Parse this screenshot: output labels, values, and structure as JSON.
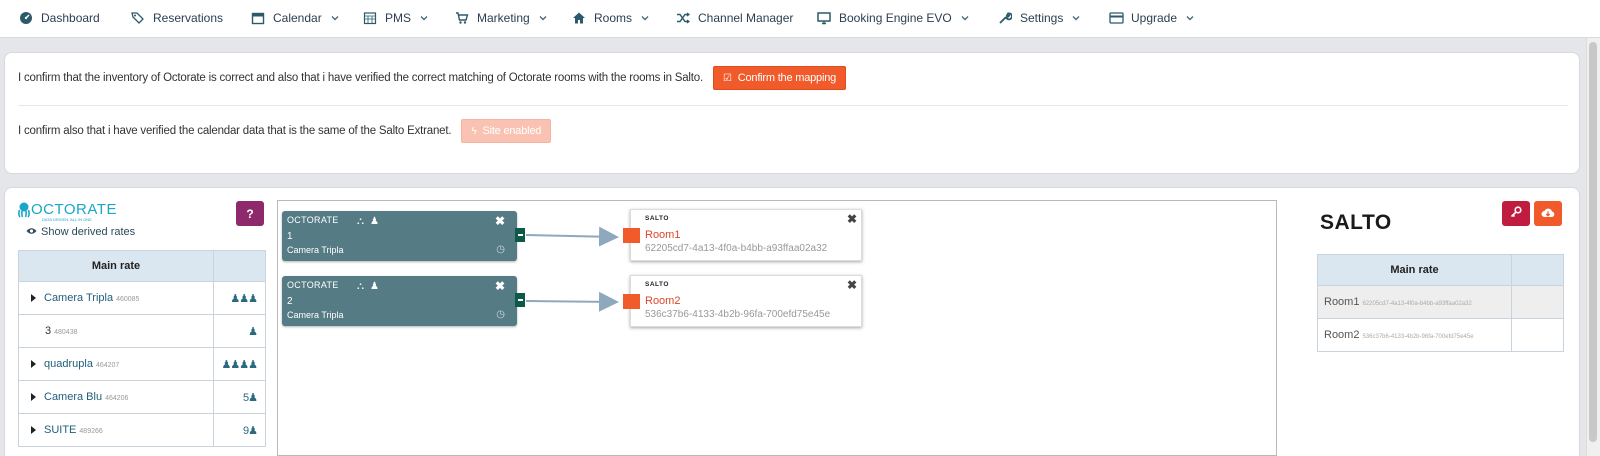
{
  "nav": [
    {
      "label": "Dashboard",
      "icon": "dashboard-icon",
      "chevron": false
    },
    {
      "label": "Reservations",
      "icon": "tags-icon",
      "chevron": false
    },
    {
      "label": "Calendar",
      "icon": "calendar-icon",
      "chevron": true
    },
    {
      "label": "PMS",
      "icon": "grid-calendar-icon",
      "chevron": true
    },
    {
      "label": "Marketing",
      "icon": "cart-icon",
      "chevron": true
    },
    {
      "label": "Rooms",
      "icon": "home-icon",
      "chevron": true
    },
    {
      "label": "Channel Manager",
      "icon": "shuffle-icon",
      "chevron": false
    },
    {
      "label": "Booking Engine EVO",
      "icon": "monitor-icon",
      "chevron": true
    },
    {
      "label": "Settings",
      "icon": "wrench-icon",
      "chevron": true
    },
    {
      "label": "Upgrade",
      "icon": "credit-card-icon",
      "chevron": true
    }
  ],
  "confirm": {
    "inventory_text": "I confirm that the inventory of Octorate is correct and also that i have verified the correct matching of Octorate rooms with the rooms in Salto.",
    "mapping_button": "Confirm the mapping",
    "calendar_text": "I confirm also that i have verified the calendar data that is the same of the Salto Extranet.",
    "site_button": "Site enabled"
  },
  "octorate_panel": {
    "logo_text": "OCTORATE",
    "logo_tagline": "DATA DRIVEN. ALL IN ONE",
    "derived_link": "Show derived rates",
    "help_label": "?",
    "table_header": "Main rate",
    "rates": [
      {
        "name": "Camera Tripla",
        "code": "460085",
        "occupancy": "♟♟♟",
        "expandable": true
      },
      {
        "name": "3",
        "code": "480438",
        "occupancy": "♟",
        "expandable": false
      },
      {
        "name": "quadrupla",
        "code": "464207",
        "occupancy": "♟♟♟♟",
        "expandable": true
      },
      {
        "name": "Camera Blu",
        "code": "464206",
        "occupancy": "5♟",
        "expandable": true
      },
      {
        "name": "SUITE",
        "code": "489266",
        "occupancy": "9♟",
        "expandable": true
      }
    ]
  },
  "mapping": {
    "octorate_nodes": [
      {
        "number": "1",
        "room": "Camera Tripla",
        "logo": "OCTORATE"
      },
      {
        "number": "2",
        "room": "Camera Tripla",
        "logo": "OCTORATE"
      }
    ],
    "salto_nodes": [
      {
        "logo": "SALTO",
        "room": "Room1",
        "id": "62205cd7-4a13-4f0a-b4bb-a93ffaa02a32"
      },
      {
        "logo": "SALTO",
        "room": "Room2",
        "id": "536c37b6-4133-4b2b-96fa-700efd75e45e"
      }
    ]
  },
  "salto_panel": {
    "logo_text": "SALTO",
    "table_header": "Main rate",
    "rooms": [
      {
        "name": "Room1",
        "code": "62205cd7-4a13-4f0a-b4bb-a93ffaa02a32"
      },
      {
        "name": "Room2",
        "code": "536c37b6-4133-4b2b-96fa-700efd75e45e"
      }
    ]
  },
  "colors": {
    "accent_orange": "#f15a2b",
    "octorate_teal": "#557b85",
    "help_purple": "#8e2a6b",
    "key_red": "#c01c40"
  }
}
